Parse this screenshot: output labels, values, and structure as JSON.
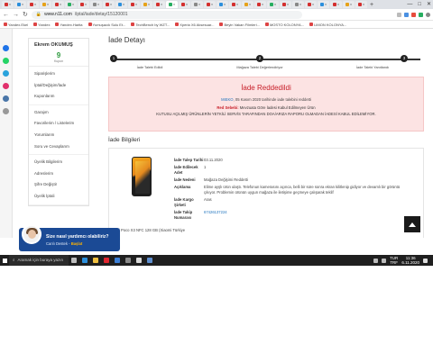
{
  "browser": {
    "tab_count": 29,
    "new_tab": "+",
    "window_controls": [
      "—",
      "□",
      "✕"
    ],
    "url_host": "www.n11.com",
    "url_path": "/iptal/iade/detay/15120001",
    "bookmarks": [
      "Yandex.Ekel",
      "Yandex",
      "Yandex.Harita",
      "Yumuşacık Sulu Et...",
      "TechBench by WZT...",
      "Xperia X6 Aksesuar...",
      "Beyin Vakan Filmleri...",
      "MOSTO KOLONYA...",
      "LIMON KOLONYA..."
    ]
  },
  "colors": {
    "accent": "#c8202a",
    "link": "#1e73be",
    "success": "#2d9a3e",
    "alert_bg": "#fce3e3",
    "chat_bg": "#1b4a95"
  },
  "rail_icons": [
    {
      "name": "messenger-icon",
      "color": "#1e73e8"
    },
    {
      "name": "whatsapp-icon",
      "color": "#25d366"
    },
    {
      "name": "telegram-icon",
      "color": "#2aa3dc"
    },
    {
      "name": "instagram-icon",
      "color": "#e1306c"
    },
    {
      "name": "vk-icon",
      "color": "#4a76a8"
    },
    {
      "name": "plus-icon",
      "color": "#999999"
    }
  ],
  "sidebar": {
    "user_name": "Ekrem OKUMUŞ",
    "count": "9",
    "count_label": "Kupon",
    "groups": [
      [
        "Siparişlerim",
        "İptal/Değişim/İade",
        "Kuponlarım"
      ],
      [
        "Garajım",
        "Favorilerim / Listelerim",
        "Yorumlarım",
        "Soru ve Cevaplarım"
      ],
      [
        "Üyelik Bilgilerim",
        "Adreslerim",
        "Şifre Değiştir",
        "Üyelik İptali"
      ]
    ]
  },
  "main": {
    "title": "İade Detayı",
    "steps": [
      {
        "num": "1",
        "label": "İade Talebi Edildi"
      },
      {
        "num": "2",
        "label": "Mağaza Talebi Değerlendiriyor"
      },
      {
        "num": "3",
        "label": "İade Talebi Yanıtlandı"
      }
    ],
    "alert": {
      "title": "İade Reddedildi",
      "code": "MIEKO",
      "date_text": "05 Kasım 2020 tarihinde iade talebini reddetti",
      "reason_label": "Red Sebebi:",
      "reason": "Mevzuata Göre İadesi Kabul Edilmeyen Ürün",
      "detail": "KUTUSU AÇILMIŞ ÜRÜNLERİN YETKİLİ SERVİS TARAFINDAN DOA/ARIZA RAPORU OLMADAN İADESİ KABUL EDİLEMİYOR."
    },
    "subtitle": "İade Bilgileri",
    "product_name": "Xiaomi Poco X3 NFC 128 GB (Xiaomi Türkiye",
    "details": [
      {
        "key": "İade Talep Tarihi",
        "value": "03.11.2020"
      },
      {
        "key": "İade Edilecek Adet",
        "value": "1"
      },
      {
        "key": "İade Nedeni",
        "value": "Mağaza Değişimi Reddetti"
      },
      {
        "key": "Açıklama",
        "value": "Elime ayşlı ürün ulaştı. Telefonun kamerasını açınca, belli bir süre sonra ekran kilitlenip gidiyor ve devamlı bir görüntü çıkıyor. Problemin ürünün uygun mağaza ile iletişime geçmeye çalışarak teklif"
      },
      {
        "key": "İade Kargo Şirketi",
        "value": "Aras"
      },
      {
        "key": "İade Takip Numarası",
        "value": "67426137224",
        "link": true
      }
    ]
  },
  "chat": {
    "line1": "Size nasıl yardımcı olabiliriz?",
    "line2": "Canlı Destek - ",
    "cta": "Başlat"
  },
  "taskbar": {
    "search_placeholder": "Aramak için buraya yazın",
    "lang": "TUR",
    "lang2": "TRF",
    "time": "11:36",
    "date": "6.11.2020",
    "apps": [
      {
        "name": "task-view-icon",
        "color": "#bdbdbd"
      },
      {
        "name": "edge-icon",
        "color": "#2b8fdc"
      },
      {
        "name": "explorer-icon",
        "color": "#f0c040"
      },
      {
        "name": "opera-icon",
        "color": "#e0262f"
      },
      {
        "name": "store-icon",
        "color": "#3c7fd6"
      },
      {
        "name": "photos-icon",
        "color": "#8a8a8a"
      },
      {
        "name": "mail-icon",
        "color": "#d9d9d9"
      },
      {
        "name": "app-icon",
        "color": "#5f8fcf"
      }
    ]
  }
}
